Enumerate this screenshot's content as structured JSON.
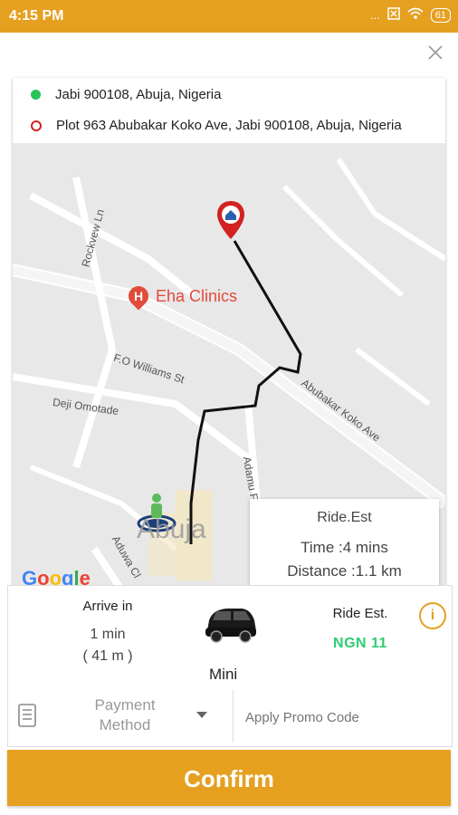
{
  "status_bar": {
    "time": "4:15 PM",
    "icons": [
      "dots-icon",
      "sim-icon",
      "wifi-icon",
      "battery-icon"
    ],
    "dots": "...",
    "battery": "61"
  },
  "colors": {
    "accent": "#e5a020",
    "green": "#27c35a",
    "red": "#d32222",
    "fare_green": "#2ecc71"
  },
  "addresses": {
    "pickup": "Jabi 900108, Abuja, Nigeria",
    "dropoff": "Plot 963 Abubakar Koko Ave, Jabi 900108, Abuja, Nigeria"
  },
  "map": {
    "labels": {
      "rockview": "Rockvew Ln",
      "fo_williams": "F.O Williams St",
      "deji": "Deji Omotade",
      "abubakar": "Abubakar Koko Ave",
      "adamu": "Adamu Fika St",
      "aduwa": "Aduwa Cl",
      "clinic": "Eha Clinics",
      "city": "Abuja"
    },
    "google_logo": "Google"
  },
  "ride_card": {
    "title": "Ride.Est",
    "time": "Time :4 mins",
    "distance": "Distance :1.1 km"
  },
  "trip": {
    "arrive_label": "Arrive in",
    "arrive_time": "1 min",
    "arrive_distance": "( 41 m )",
    "vehicle": "Mini",
    "fare_label": "Ride Est.",
    "fare_value": "NGN 11"
  },
  "payment": {
    "label_line1": "Payment",
    "label_line2": "Method",
    "promo_placeholder": "Apply Promo Code"
  },
  "confirm_label": "Confirm"
}
